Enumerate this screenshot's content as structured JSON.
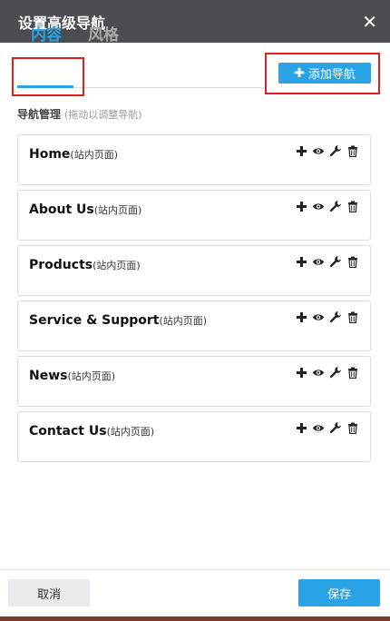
{
  "dialog": {
    "title": "设置高级导航",
    "close_icon": "close-icon"
  },
  "tabs": [
    {
      "label": "内容",
      "active": true
    },
    {
      "label": "风格",
      "active": false
    }
  ],
  "toolbar": {
    "add_label": "添加导航",
    "add_icon": "plus-icon"
  },
  "section": {
    "label": "导航管理",
    "hint": "(拖动以调整导航)"
  },
  "nav_items": [
    {
      "name": "Home",
      "type": "(站内页面)"
    },
    {
      "name": "About Us",
      "type": "(站内页面)"
    },
    {
      "name": "Products",
      "type": "(站内页面)"
    },
    {
      "name": "Service & Support",
      "type": "(站内页面)"
    },
    {
      "name": "News",
      "type": "(站内页面)"
    },
    {
      "name": "Contact Us",
      "type": "(站内页面)"
    }
  ],
  "item_actions": [
    "plus-icon",
    "eye-icon",
    "wrench-icon",
    "trash-icon"
  ],
  "footer": {
    "cancel_label": "取消",
    "save_label": "保存"
  },
  "colors": {
    "accent": "#29a3e6",
    "titlebar": "#4a4d52",
    "highlight": "#e02020"
  }
}
